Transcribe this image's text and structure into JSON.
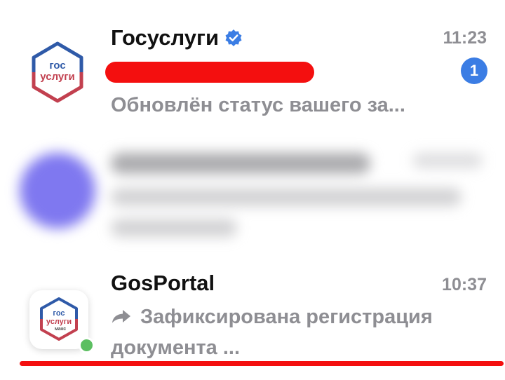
{
  "chats": [
    {
      "title": "Госуслуги",
      "verified": true,
      "time": "11:23",
      "sender_redacted": true,
      "unread_count": "1",
      "preview": "Обновлён статус вашего за...",
      "avatar": {
        "line1": "гос",
        "line2": "услуги",
        "ring_colors": [
          "#2f5aa8",
          "#c2404f"
        ]
      }
    },
    {
      "blurred": true,
      "avatar_color": "#7f78f0"
    },
    {
      "title": "GosPortal",
      "time": "10:37",
      "online": true,
      "forwarded": true,
      "preview": "Зафиксирована регистрация документа ...",
      "avatar": {
        "line1": "гос",
        "line2": "услуги",
        "line3": "макс",
        "ring_colors": [
          "#2f5aa8",
          "#c2404f"
        ]
      }
    }
  ],
  "colors": {
    "accent": "#3b7de4",
    "redaction": "#f40f0f",
    "online": "#5cbf61",
    "secondary_text": "#8e8e93"
  }
}
